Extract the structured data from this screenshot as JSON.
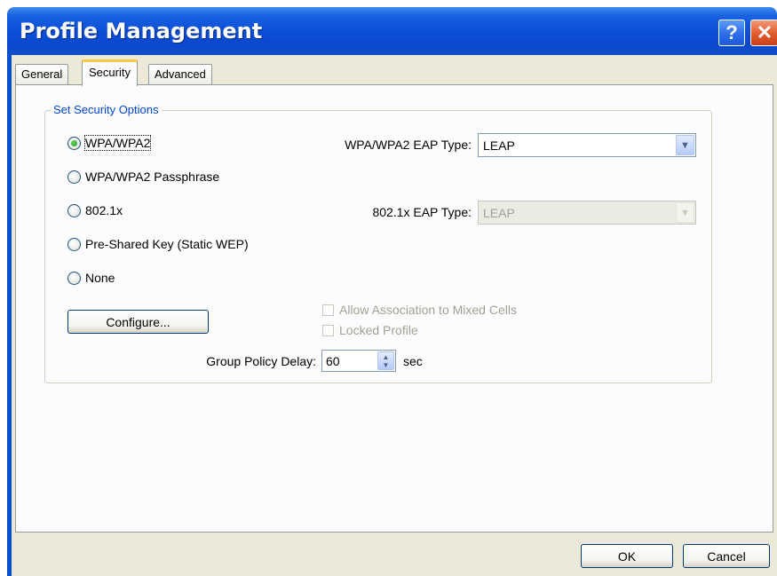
{
  "window": {
    "title": "Profile Management"
  },
  "titlebar": {
    "help_glyph": "?",
    "close_glyph": "✕"
  },
  "tabs": [
    {
      "label": "General"
    },
    {
      "label": "Security"
    },
    {
      "label": "Advanced"
    }
  ],
  "security": {
    "group_label": "Set Security Options",
    "options": [
      {
        "label": "WPA/WPA2",
        "selected": true
      },
      {
        "label": "WPA/WPA2 Passphrase",
        "selected": false
      },
      {
        "label": "802.1x",
        "selected": false
      },
      {
        "label": "Pre-Shared Key (Static WEP)",
        "selected": false
      },
      {
        "label": "None",
        "selected": false
      }
    ],
    "wpa_eap_label": "WPA/WPA2 EAP Type:",
    "wpa_eap_value": "LEAP",
    "dot1x_eap_label": "802.1x EAP Type:",
    "dot1x_eap_value": "LEAP",
    "configure_label": "Configure...",
    "allow_mixed_label": "Allow Association to Mixed Cells",
    "locked_profile_label": "Locked Profile",
    "group_policy_label": "Group Policy Delay:",
    "group_policy_value": "60",
    "group_policy_unit": "sec"
  },
  "footer": {
    "ok_label": "OK",
    "cancel_label": "Cancel"
  },
  "colors": {
    "title_bar": "#0b4fd8",
    "group_label": "#0046d5",
    "tab_highlight": "#ffc83c"
  }
}
